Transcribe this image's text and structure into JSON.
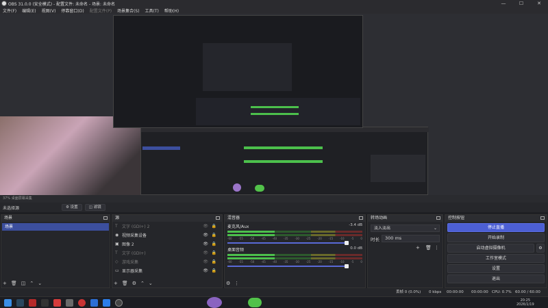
{
  "titlebar": {
    "title": "OBS 31.0.0 (安全模式) - 配置文件: 未命名 - 场景: 未命名"
  },
  "menu": [
    "文件(F)",
    "编辑(E)",
    "视图(V)",
    "停靠窗口(D)",
    "配置文件(P)",
    "场景集合(S)",
    "工具(T)",
    "帮助(H)"
  ],
  "preview": {
    "status_text": "37%  桌面屏幕采集"
  },
  "toolbar": {
    "no_source": "未选择源",
    "settings": "⚙ 设置",
    "filters": "◫ 滤镜"
  },
  "scenes": {
    "title": "场景",
    "items": [
      "场景"
    ]
  },
  "sources": {
    "title": "源",
    "items": [
      {
        "label": "文字 (GDI+) 2",
        "icon": "text-icon",
        "dim": true
      },
      {
        "label": "视频采集设备",
        "icon": "camera-icon",
        "dim": false
      },
      {
        "label": "图像 2",
        "icon": "image-icon",
        "dim": false
      },
      {
        "label": "文字 (GDI+)",
        "icon": "text-icon",
        "dim": true
      },
      {
        "label": "游戏采集",
        "icon": "gamepad-icon",
        "dim": true
      },
      {
        "label": "显示器采集",
        "icon": "monitor-icon",
        "dim": false
      }
    ]
  },
  "mixer": {
    "title": "混音器",
    "channels": [
      {
        "name": "麦克风/Aux",
        "db": "-3.4 dB",
        "active": true
      },
      {
        "name": "桌面音频",
        "db": "0.0 dB",
        "active": true
      }
    ],
    "ticks": [
      "-60",
      "-55",
      "-50",
      "-45",
      "-40",
      "-35",
      "-30",
      "-25",
      "-20",
      "-15",
      "-10",
      "-5",
      "0"
    ]
  },
  "transitions": {
    "title": "转场动画",
    "selected": "淡入淡出",
    "duration_label": "时长",
    "duration_value": "300 ms"
  },
  "controls": {
    "title": "控制按钮",
    "buttons": [
      "停止直播",
      "开始录制",
      "启动虚拟摄像机",
      "工作室模式",
      "设置",
      "退出"
    ]
  },
  "statusbar": {
    "dropped": "丢帧 0 (0.0%)",
    "bitrate": "0 kbps",
    "stream_time": "00:00:00",
    "rec_time": "00:00:00",
    "cpu": "CPU: 0.7%",
    "fps": "60.00 / 60.00 FPS"
  },
  "taskbar": {
    "time": "20:25",
    "date": "2026/1/19"
  },
  "colors": {
    "accent": "#4c5fd4",
    "panel": "#25262a",
    "bg": "#1e1f23"
  }
}
